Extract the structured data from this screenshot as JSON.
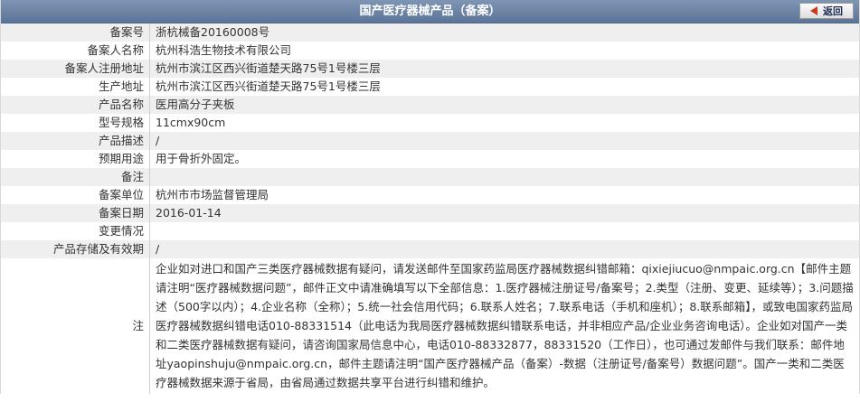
{
  "header": {
    "title": "国产医疗器械产品（备案）",
    "back_label": "返回"
  },
  "rows": [
    {
      "label": "备案号",
      "value": "浙杭械备20160008号"
    },
    {
      "label": "备案人名称",
      "value": "杭州科浩生物技术有限公司"
    },
    {
      "label": "备案人注册地址",
      "value": "杭州市滨江区西兴街道楚天路75号1号楼三层"
    },
    {
      "label": "生产地址",
      "value": "杭州市滨江区西兴街道楚天路75号1号楼三层"
    },
    {
      "label": "产品名称",
      "value": "医用高分子夹板"
    },
    {
      "label": "型号规格",
      "value": "11cmx90cm"
    },
    {
      "label": "产品描述",
      "value": "/"
    },
    {
      "label": "预期用途",
      "value": "用于骨折外固定。"
    },
    {
      "label": "备注",
      "value": ""
    },
    {
      "label": "备案单位",
      "value": "杭州市市场监督管理局"
    },
    {
      "label": "备案日期",
      "value": "2016-01-14"
    },
    {
      "label": "变更情况",
      "value": ""
    },
    {
      "label": "产品存储及有效期",
      "value": "/"
    }
  ],
  "note": {
    "label": "注",
    "text": "企业如对进口和国产三类医疗器械数据有疑问，请发送邮件至国家药监局医疗器械数据纠错邮箱：qixiejiucuo@nmpaic.org.cn【邮件主题请注明“医疗器械数据问题”，邮件正文中请准确填写以下全部信息：1.医疗器械注册证号/备案号；2.类型（注册、变更、延续等）；3.问题描述（500字以内）；4.企业名称（全称）；5.统一社会信用代码；6.联系人姓名；7.联系电话（手机和座机）；8.联系邮箱】，或致电国家药监局医疗器械数据纠错电话010-88331514（此电话为我局医疗器械数据纠错联系电话，并非相应产品/企业业务咨询电话）。企业如对国产一类和二类医疗器械数据有疑问，请咨询国家局信息中心，电话010-88332877，88331520（工作日），也可通过发邮件与我们联系：邮件地址yaopinshuju@nmpaic.org.cn，邮件主题请注明“国产医疗器械产品（备案）-数据（注册证号/备案号）数据问题”。国产一类和二类医疗器械数据来源于省局，由省局通过数据共享平台进行纠错和维护。"
  },
  "colors": {
    "header_bg": "#6a82a6",
    "row_alt_bg": "#efefef",
    "back_arrow": "#c63d1e"
  }
}
